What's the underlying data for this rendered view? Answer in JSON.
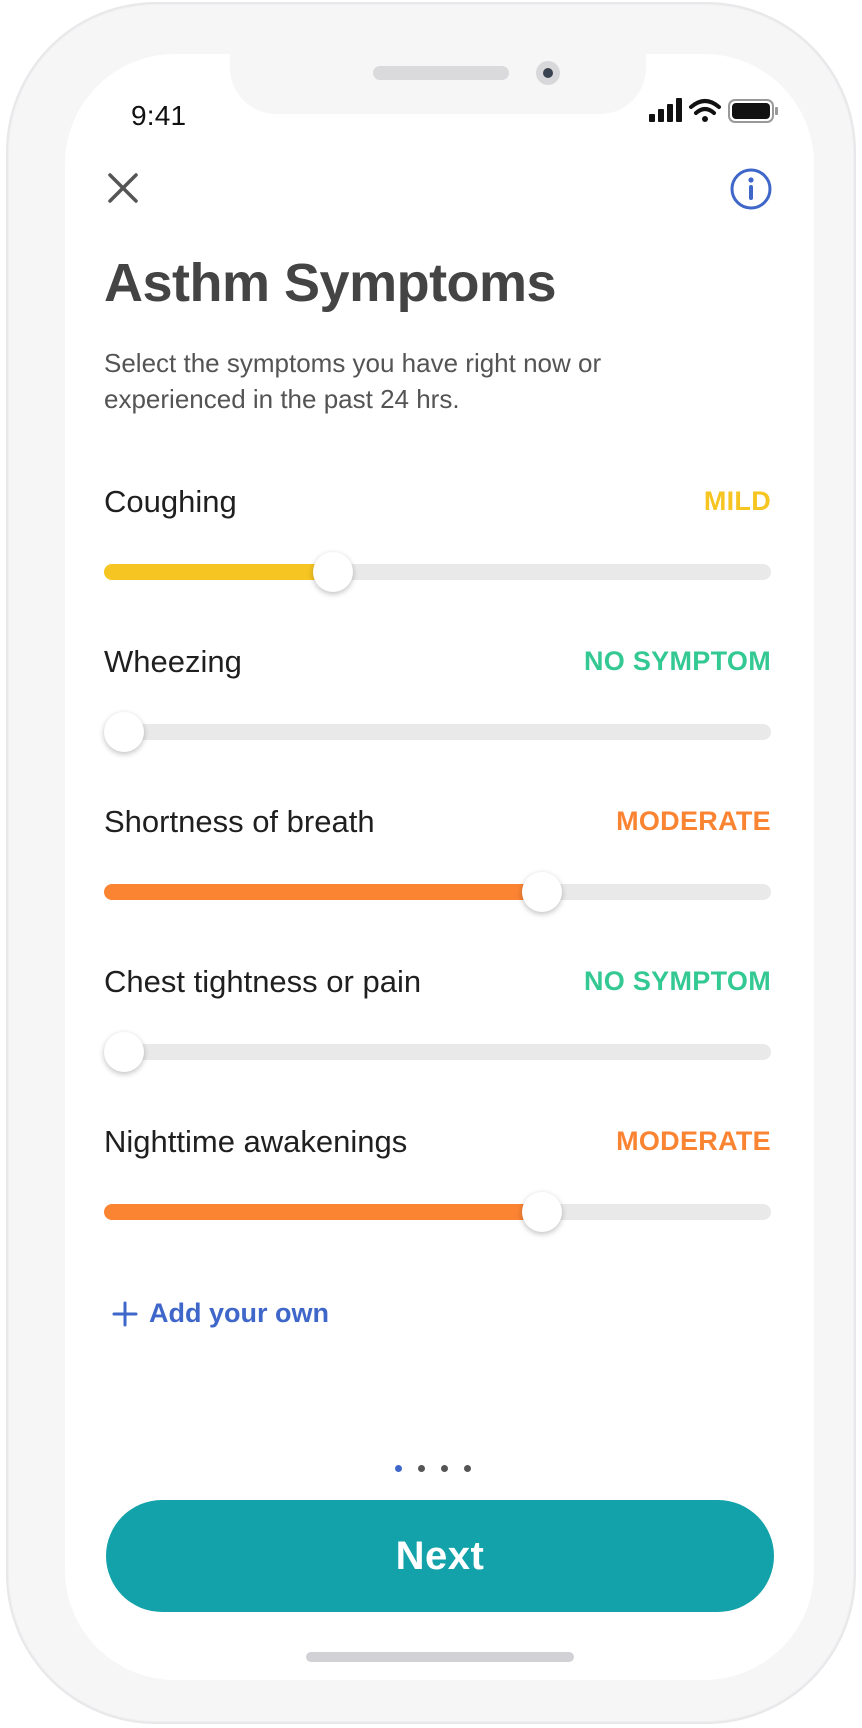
{
  "status_bar": {
    "time": "9:41"
  },
  "header": {
    "title": "Asthm Symptoms",
    "subtitle": "Select the symptoms you have right now or experienced in the past 24 hrs."
  },
  "symptoms": [
    {
      "name": "Coughing",
      "level": "MILD",
      "level_color": "#f6c521",
      "value": 0.333
    },
    {
      "name": "Wheezing",
      "level": "NO SYMPTOM",
      "level_color": "#34c993",
      "value": 0
    },
    {
      "name": "Shortness of breath",
      "level": "MODERATE",
      "level_color": "#fb8433",
      "value": 0.667
    },
    {
      "name": "Chest tightness or pain",
      "level": "NO SYMPTOM",
      "level_color": "#34c993",
      "value": 0
    },
    {
      "name": "Nighttime awakenings",
      "level": "MODERATE",
      "level_color": "#fb8433",
      "value": 0.667
    }
  ],
  "add_own": {
    "label": "Add your own"
  },
  "pager": {
    "count": 4,
    "active": 0
  },
  "next_button": {
    "label": "Next"
  },
  "colors": {
    "accent": "#13a2aa",
    "link": "#3f66c9",
    "track": "#e9e9e9"
  }
}
